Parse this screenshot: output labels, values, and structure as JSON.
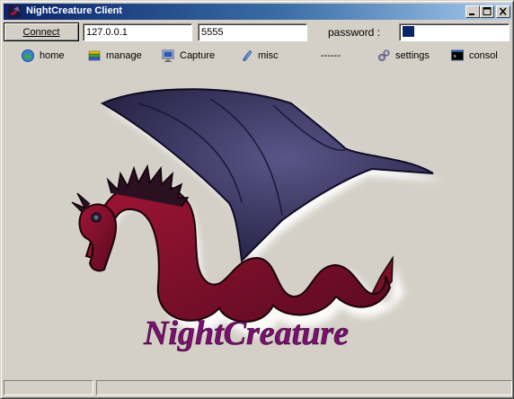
{
  "window": {
    "title": "NightCreature Client"
  },
  "connection": {
    "connect_label": "Connect",
    "host_value": "127.0.0.1",
    "port_value": "5555",
    "password_label": "password :"
  },
  "menu": {
    "items": [
      {
        "label": "home",
        "icon": "home-icon"
      },
      {
        "label": "manage",
        "icon": "manage-icon"
      },
      {
        "label": "Capture",
        "icon": "capture-icon"
      },
      {
        "label": "misc",
        "icon": "paperclip-icon"
      },
      {
        "label": "------",
        "icon": ""
      },
      {
        "label": "settings",
        "icon": "gears-icon"
      },
      {
        "label": "consol",
        "icon": "console-icon"
      }
    ]
  },
  "logo": {
    "text": "NightCreature"
  },
  "statusbar": {
    "panel1": "",
    "panel2": ""
  },
  "colors": {
    "title_gradient_start": "#0a246a",
    "title_gradient_end": "#a6caf0",
    "dragon_body": "#8b1030",
    "dragon_wing": "#3a3560",
    "logo_text": "#7a1070",
    "window_face": "#d4d0c8"
  }
}
